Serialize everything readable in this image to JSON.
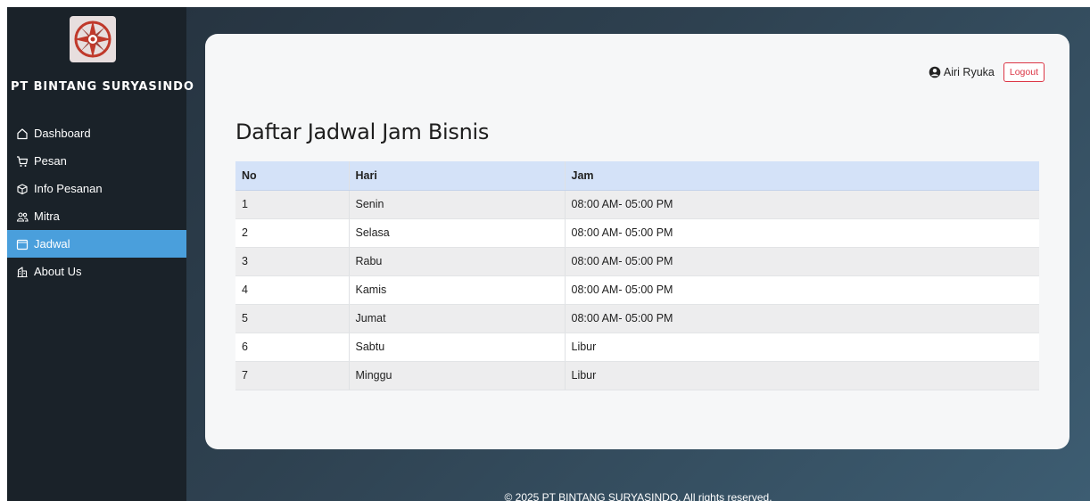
{
  "brand": {
    "name": "PT BINTANG SURYASINDO",
    "logo": "compass-star-logo"
  },
  "sidebar": {
    "items": [
      {
        "label": "Dashboard",
        "icon": "home-icon",
        "active": false
      },
      {
        "label": "Pesan",
        "icon": "cart-icon",
        "active": false
      },
      {
        "label": "Info Pesanan",
        "icon": "box-icon",
        "active": false
      },
      {
        "label": "Mitra",
        "icon": "people-icon",
        "active": false
      },
      {
        "label": "Jadwal",
        "icon": "calendar-icon",
        "active": true
      },
      {
        "label": "About Us",
        "icon": "buildings-icon",
        "active": false
      }
    ]
  },
  "header": {
    "user_name": "Airi Ryuka",
    "user_icon": "person-circle-icon",
    "logout_label": "Logout"
  },
  "main": {
    "title": "Daftar Jadwal Jam Bisnis",
    "table": {
      "headers": [
        "No",
        "Hari",
        "Jam"
      ],
      "rows": [
        [
          "1",
          "Senin",
          "08:00 AM- 05:00 PM"
        ],
        [
          "2",
          "Selasa",
          "08:00 AM- 05:00 PM"
        ],
        [
          "3",
          "Rabu",
          "08:00 AM- 05:00 PM"
        ],
        [
          "4",
          "Kamis",
          "08:00 AM- 05:00 PM"
        ],
        [
          "5",
          "Jumat",
          "08:00 AM- 05:00 PM"
        ],
        [
          "6",
          "Sabtu",
          "Libur"
        ],
        [
          "7",
          "Minggu",
          "Libur"
        ]
      ]
    }
  },
  "footer": {
    "text": "© 2025 PT BINTANG SURYASINDO. All rights reserved."
  },
  "colors": {
    "sidebar_bg": "#1a2229",
    "active_item": "#4a9fdc",
    "table_header": "#d4e2f8",
    "logout": "#dc3545"
  }
}
